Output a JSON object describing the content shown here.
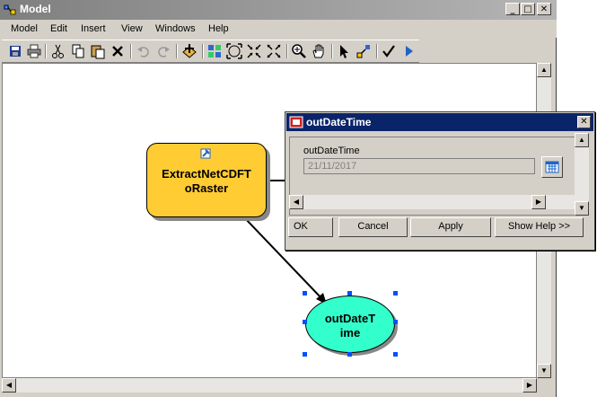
{
  "window": {
    "title": "Model",
    "caption_buttons": [
      "_",
      "□",
      "✕"
    ]
  },
  "menu": {
    "items": [
      "Model",
      "Edit",
      "Insert",
      "View",
      "Windows",
      "Help"
    ]
  },
  "toolbar": {
    "icons": [
      "save-icon",
      "print-icon",
      "cut-icon",
      "copy-icon",
      "paste-icon",
      "delete-icon",
      "undo-icon",
      "redo-icon",
      "add-data-icon",
      "auto-layout-icon",
      "full-extent-icon",
      "zoom-fixed-in-icon",
      "zoom-fixed-out-icon",
      "zoom-in-icon",
      "pan-icon",
      "select-icon",
      "add-connection-icon",
      "validate-icon",
      "run-icon"
    ]
  },
  "model": {
    "tool_label": "ExtractNetCDFT\noRaster",
    "variable_label": "outDateT\nime"
  },
  "dialog": {
    "title": "outDateTime",
    "param_label": "outDateTime",
    "param_value": "21/11/2017",
    "buttons": {
      "ok": "OK",
      "cancel": "Cancel",
      "apply": "Apply",
      "help": "Show Help >>"
    }
  },
  "colors": {
    "tool_fill": "#ffcc33",
    "variable_fill": "#33ffcc",
    "dialog_title_bg": "#0a246a",
    "selection_handle": "#0050ff"
  }
}
